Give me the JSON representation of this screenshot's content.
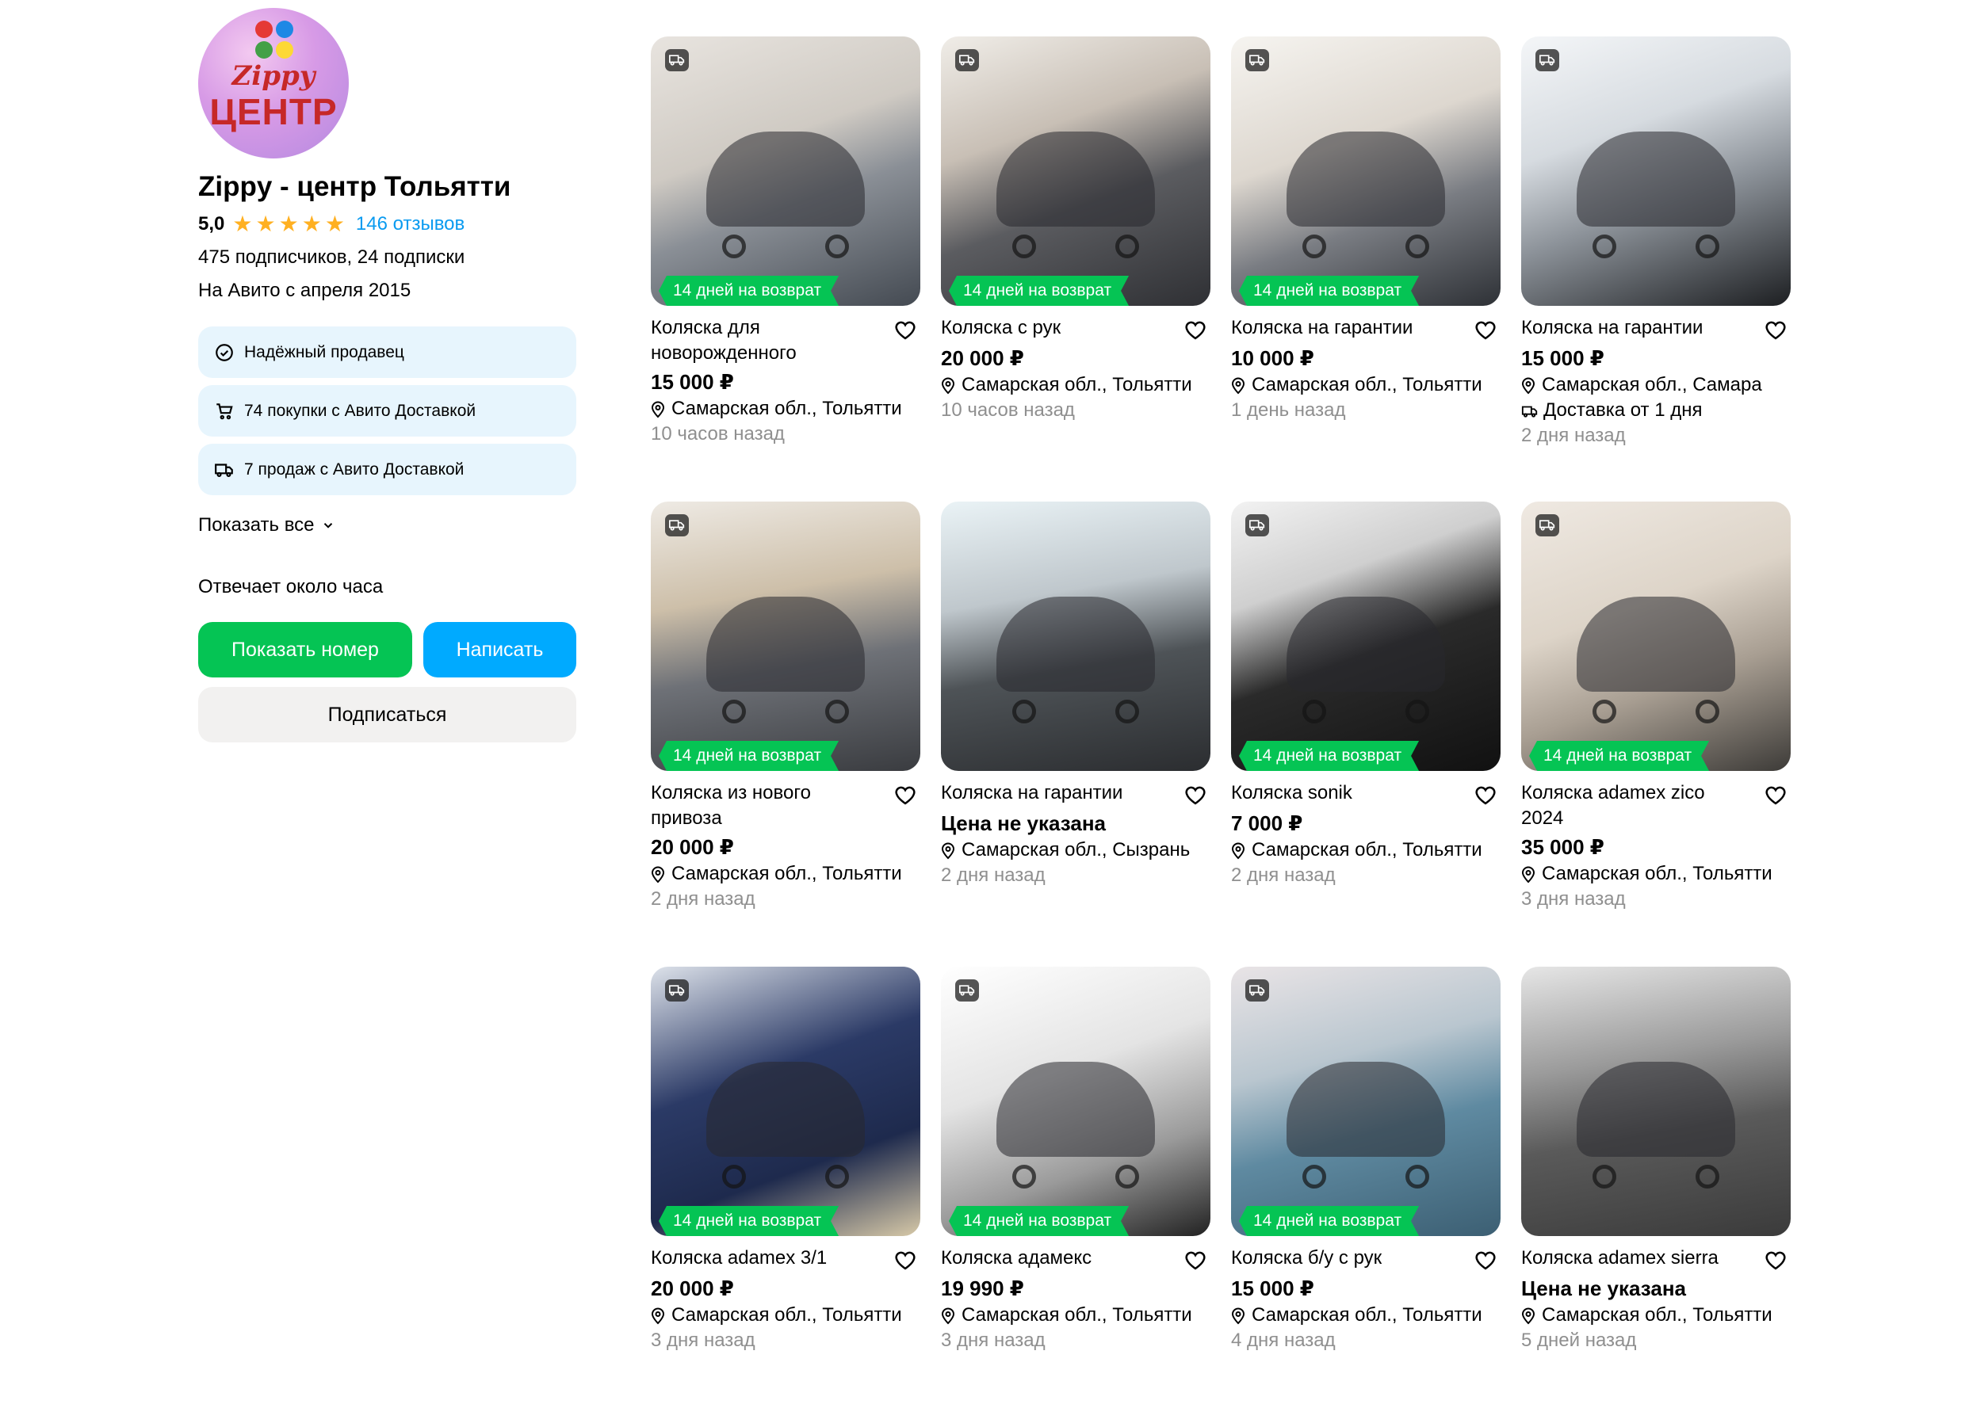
{
  "seller": {
    "logo_top": "Zippy",
    "logo_bottom": "ЦЕНТР",
    "name": "Zippy - центр Тольятти",
    "rating": "5,0",
    "stars": 5,
    "reviews": "146 отзывов",
    "followers": "475 подписчиков, 24 подписки",
    "since": "На Авито с апреля 2015",
    "badges": [
      {
        "icon": "check-circle-icon",
        "label": "Надёжный продавец"
      },
      {
        "icon": "cart-icon",
        "label": "74 покупки с Авито Доставкой"
      },
      {
        "icon": "truck-icon",
        "label": "7 продаж с Авито Доставкой"
      }
    ],
    "show_all": "Показать все",
    "responds": "Отвечает около часа",
    "show_phone": "Показать номер",
    "write": "Написать",
    "subscribe": "Подписаться"
  },
  "colors": {
    "green": "#05c454",
    "blue": "#00aaff",
    "link": "#0a9bf0",
    "star": "#ffb021"
  },
  "listings": [
    {
      "title": "Коляска для новорожденного",
      "price": "15 000 ₽",
      "location": "Самарская обл., Тольятти",
      "time": "10 часов назад",
      "badge": "14 дней на возврат",
      "delivery_icon": true
    },
    {
      "title": "Коляска с рук",
      "price": "20 000 ₽",
      "location": "Самарская обл., Тольятти",
      "time": "10 часов назад",
      "badge": "14 дней на возврат",
      "delivery_icon": true
    },
    {
      "title": "Коляска на гарантии",
      "price": "10 000 ₽",
      "location": "Самарская обл., Тольятти",
      "time": "1 день назад",
      "badge": "14 дней на возврат",
      "delivery_icon": true
    },
    {
      "title": "Коляска на гарантии",
      "price": "15 000 ₽",
      "location": "Самарская обл., Самара",
      "delivery": "Доставка от 1 дня",
      "time": "2 дня назад",
      "badge": "",
      "delivery_icon": true
    },
    {
      "title": "Коляска из нового привоза",
      "price": "20 000 ₽",
      "location": "Самарская обл., Тольятти",
      "time": "2 дня назад",
      "badge": "14 дней на возврат",
      "delivery_icon": true
    },
    {
      "title": "Коляска на гарантии",
      "price": "Цена не указана",
      "location": "Самарская обл., Сызрань",
      "time": "2 дня назад",
      "badge": "",
      "delivery_icon": false
    },
    {
      "title": "Коляска sonik",
      "price": "7 000 ₽",
      "location": "Самарская обл., Тольятти",
      "time": "2 дня назад",
      "badge": "14 дней на возврат",
      "delivery_icon": true
    },
    {
      "title": "Коляска adamex zico 2024",
      "price": "35 000 ₽",
      "location": "Самарская обл., Тольятти",
      "time": "3 дня назад",
      "badge": "14 дней на возврат",
      "delivery_icon": true
    },
    {
      "title": "Коляска adamex 3/1",
      "price": "20 000 ₽",
      "location": "Самарская обл., Тольятти",
      "time": "3 дня назад",
      "badge": "14 дней на возврат",
      "delivery_icon": true
    },
    {
      "title": "Коляска адамекс",
      "price": "19 990 ₽",
      "location": "Самарская обл., Тольятти",
      "time": "3 дня назад",
      "badge": "14 дней на возврат",
      "delivery_icon": true
    },
    {
      "title": "Коляска б/у с рук",
      "price": "15 000 ₽",
      "location": "Самарская обл., Тольятти",
      "time": "4 дня назад",
      "badge": "14 дней на возврат",
      "delivery_icon": true
    },
    {
      "title": "Коляска adamex sierra",
      "price": "Цена не указана",
      "location": "Самарская обл., Тольятти",
      "time": "5 дней назад",
      "badge": "",
      "delivery_icon": false
    }
  ]
}
